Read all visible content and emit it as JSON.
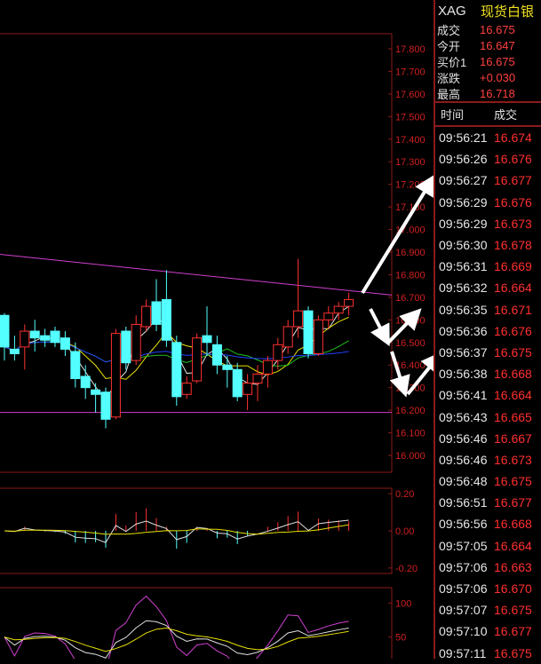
{
  "header": {
    "symbol": "XAG",
    "name": "现货白银"
  },
  "quote": [
    {
      "label": "成交",
      "value": "16.675"
    },
    {
      "label": "今开",
      "value": "16.647"
    },
    {
      "label": "买价1",
      "value": "16.675"
    },
    {
      "label": "涨跌",
      "value": "+0.030"
    },
    {
      "label": "最高",
      "value": "16.718"
    }
  ],
  "ticks_header": {
    "time": "时间",
    "price": "成交"
  },
  "ticks": [
    {
      "time": "09:56:21",
      "price": "16.674"
    },
    {
      "time": "09:56:26",
      "price": "16.676"
    },
    {
      "time": "09:56:27",
      "price": "16.677"
    },
    {
      "time": "09:56:29",
      "price": "16.676"
    },
    {
      "time": "09:56:29",
      "price": "16.673"
    },
    {
      "time": "09:56:30",
      "price": "16.678"
    },
    {
      "time": "09:56:31",
      "price": "16.669"
    },
    {
      "time": "09:56:32",
      "price": "16.664"
    },
    {
      "time": "09:56:35",
      "price": "16.671"
    },
    {
      "time": "09:56:36",
      "price": "16.676"
    },
    {
      "time": "09:56:37",
      "price": "16.675"
    },
    {
      "time": "09:56:38",
      "price": "16.668"
    },
    {
      "time": "09:56:41",
      "price": "16.664"
    },
    {
      "time": "09:56:43",
      "price": "16.665"
    },
    {
      "time": "09:56:46",
      "price": "16.667"
    },
    {
      "time": "09:56:46",
      "price": "16.673"
    },
    {
      "time": "09:56:48",
      "price": "16.675"
    },
    {
      "time": "09:56:51",
      "price": "16.677"
    },
    {
      "time": "09:56:56",
      "price": "16.668"
    },
    {
      "time": "09:57:05",
      "price": "16.664"
    },
    {
      "time": "09:57:06",
      "price": "16.663"
    },
    {
      "time": "09:57:06",
      "price": "16.670"
    },
    {
      "time": "09:57:07",
      "price": "16.675"
    },
    {
      "time": "09:57:10",
      "price": "16.677"
    },
    {
      "time": "09:57:11",
      "price": "16.675"
    }
  ],
  "colors": {
    "up": "#ff3030",
    "down": "#54ffff",
    "ma_white": "#e0e0e0",
    "ma_yellow": "#e8e000",
    "ma_green": "#20c020",
    "ma_blue": "#2040ff",
    "trend": "#d040d0",
    "grid": "#8b1a1a"
  },
  "chart_data": [
    {
      "type": "candlestick",
      "y_ticks": [
        "17.800",
        "17.700",
        "17.600",
        "17.500",
        "17.400",
        "17.300",
        "17.200",
        "17.100",
        "17.000",
        "16.900",
        "16.800",
        "16.700",
        "16.600",
        "16.500",
        "16.400",
        "16.300",
        "16.200",
        "16.100",
        "16.000"
      ],
      "ylim": [
        16.0,
        17.8
      ],
      "candles": [
        {
          "o": 16.62,
          "h": 16.63,
          "l": 16.42,
          "c": 16.48
        },
        {
          "o": 16.47,
          "h": 16.53,
          "l": 16.42,
          "c": 16.45
        },
        {
          "o": 16.48,
          "h": 16.58,
          "l": 16.38,
          "c": 16.55
        },
        {
          "o": 16.55,
          "h": 16.6,
          "l": 16.46,
          "c": 16.52
        },
        {
          "o": 16.53,
          "h": 16.56,
          "l": 16.48,
          "c": 16.51
        },
        {
          "o": 16.55,
          "h": 16.57,
          "l": 16.48,
          "c": 16.5
        },
        {
          "o": 16.52,
          "h": 16.55,
          "l": 16.44,
          "c": 16.47
        },
        {
          "o": 16.46,
          "h": 16.5,
          "l": 16.3,
          "c": 16.34
        },
        {
          "o": 16.35,
          "h": 16.4,
          "l": 16.25,
          "c": 16.3
        },
        {
          "o": 16.29,
          "h": 16.32,
          "l": 16.19,
          "c": 16.27
        },
        {
          "o": 16.28,
          "h": 16.3,
          "l": 16.12,
          "c": 16.16
        },
        {
          "o": 16.17,
          "h": 16.56,
          "l": 16.16,
          "c": 16.54
        },
        {
          "o": 16.55,
          "h": 16.57,
          "l": 16.38,
          "c": 16.41
        },
        {
          "o": 16.42,
          "h": 16.62,
          "l": 16.4,
          "c": 16.58
        },
        {
          "o": 16.57,
          "h": 16.69,
          "l": 16.55,
          "c": 16.66
        },
        {
          "o": 16.68,
          "h": 16.78,
          "l": 16.55,
          "c": 16.58
        },
        {
          "o": 16.69,
          "h": 16.82,
          "l": 16.48,
          "c": 16.51
        },
        {
          "o": 16.5,
          "h": 16.53,
          "l": 16.22,
          "c": 16.26
        },
        {
          "o": 16.27,
          "h": 16.35,
          "l": 16.25,
          "c": 16.32
        },
        {
          "o": 16.33,
          "h": 16.54,
          "l": 16.32,
          "c": 16.52
        },
        {
          "o": 16.53,
          "h": 16.66,
          "l": 16.44,
          "c": 16.5
        },
        {
          "o": 16.49,
          "h": 16.53,
          "l": 16.36,
          "c": 16.4
        },
        {
          "o": 16.4,
          "h": 16.44,
          "l": 16.3,
          "c": 16.38
        },
        {
          "o": 16.38,
          "h": 16.41,
          "l": 16.24,
          "c": 16.26
        },
        {
          "o": 16.27,
          "h": 16.36,
          "l": 16.2,
          "c": 16.32
        },
        {
          "o": 16.32,
          "h": 16.4,
          "l": 16.24,
          "c": 16.36
        },
        {
          "o": 16.36,
          "h": 16.44,
          "l": 16.3,
          "c": 16.42
        },
        {
          "o": 16.42,
          "h": 16.52,
          "l": 16.38,
          "c": 16.49
        },
        {
          "o": 16.48,
          "h": 16.6,
          "l": 16.45,
          "c": 16.57
        },
        {
          "o": 16.57,
          "h": 16.87,
          "l": 16.52,
          "c": 16.64
        },
        {
          "o": 16.64,
          "h": 16.66,
          "l": 16.43,
          "c": 16.45
        },
        {
          "o": 16.45,
          "h": 16.62,
          "l": 16.44,
          "c": 16.6
        },
        {
          "o": 16.6,
          "h": 16.66,
          "l": 16.56,
          "c": 16.63
        },
        {
          "o": 16.63,
          "h": 16.68,
          "l": 16.6,
          "c": 16.66
        },
        {
          "o": 16.66,
          "h": 16.72,
          "l": 16.62,
          "c": 16.69
        }
      ],
      "trend_lines": [
        {
          "from": [
            0,
            16.89
          ],
          "to": [
            34,
            16.71
          ]
        },
        {
          "from": [
            0,
            16.19
          ],
          "to": [
            34,
            16.19
          ]
        }
      ]
    },
    {
      "type": "line",
      "y_ticks": [
        "0.20",
        "0.00",
        "-0.20"
      ],
      "ylim": [
        -0.22,
        0.22
      ]
    },
    {
      "type": "line",
      "y_ticks": [
        "100",
        "50"
      ],
      "ylim": [
        0,
        120
      ]
    }
  ]
}
